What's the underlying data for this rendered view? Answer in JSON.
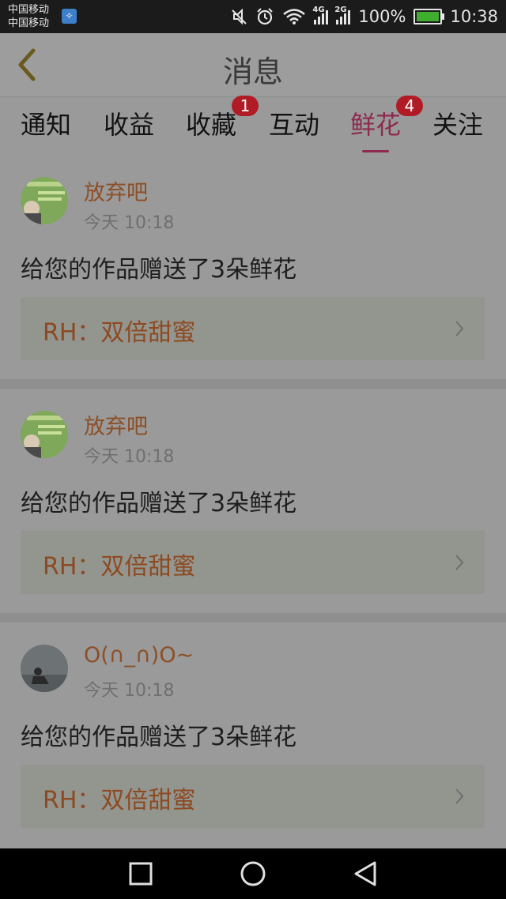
{
  "status": {
    "carrier1": "中国移动",
    "carrier2": "中国移动",
    "net1": "4G",
    "net2": "2G",
    "battery": "100%",
    "time": "10:38"
  },
  "header": {
    "title": "消息"
  },
  "tabs": [
    {
      "label": "通知",
      "badge": ""
    },
    {
      "label": "收益",
      "badge": ""
    },
    {
      "label": "收藏",
      "badge": "1"
    },
    {
      "label": "互动",
      "badge": ""
    },
    {
      "label": "鲜花",
      "badge": "4",
      "active": true
    },
    {
      "label": "关注",
      "badge": ""
    }
  ],
  "messages": [
    {
      "user": "放弃吧",
      "time": "今天 10:18",
      "text": "给您的作品赠送了3朵鲜花",
      "link": "RH：双倍甜蜜"
    },
    {
      "user": "放弃吧",
      "time": "今天 10:18",
      "text": "给您的作品赠送了3朵鲜花",
      "link": "RH：双倍甜蜜"
    },
    {
      "user": "O(∩_∩)O~",
      "time": "今天 10:18",
      "text": "给您的作品赠送了3朵鲜花",
      "link": "RH：双倍甜蜜"
    }
  ],
  "colors": {
    "accent": "#8e2a4f",
    "badge": "#b01b25",
    "username": "#8c4f26"
  }
}
